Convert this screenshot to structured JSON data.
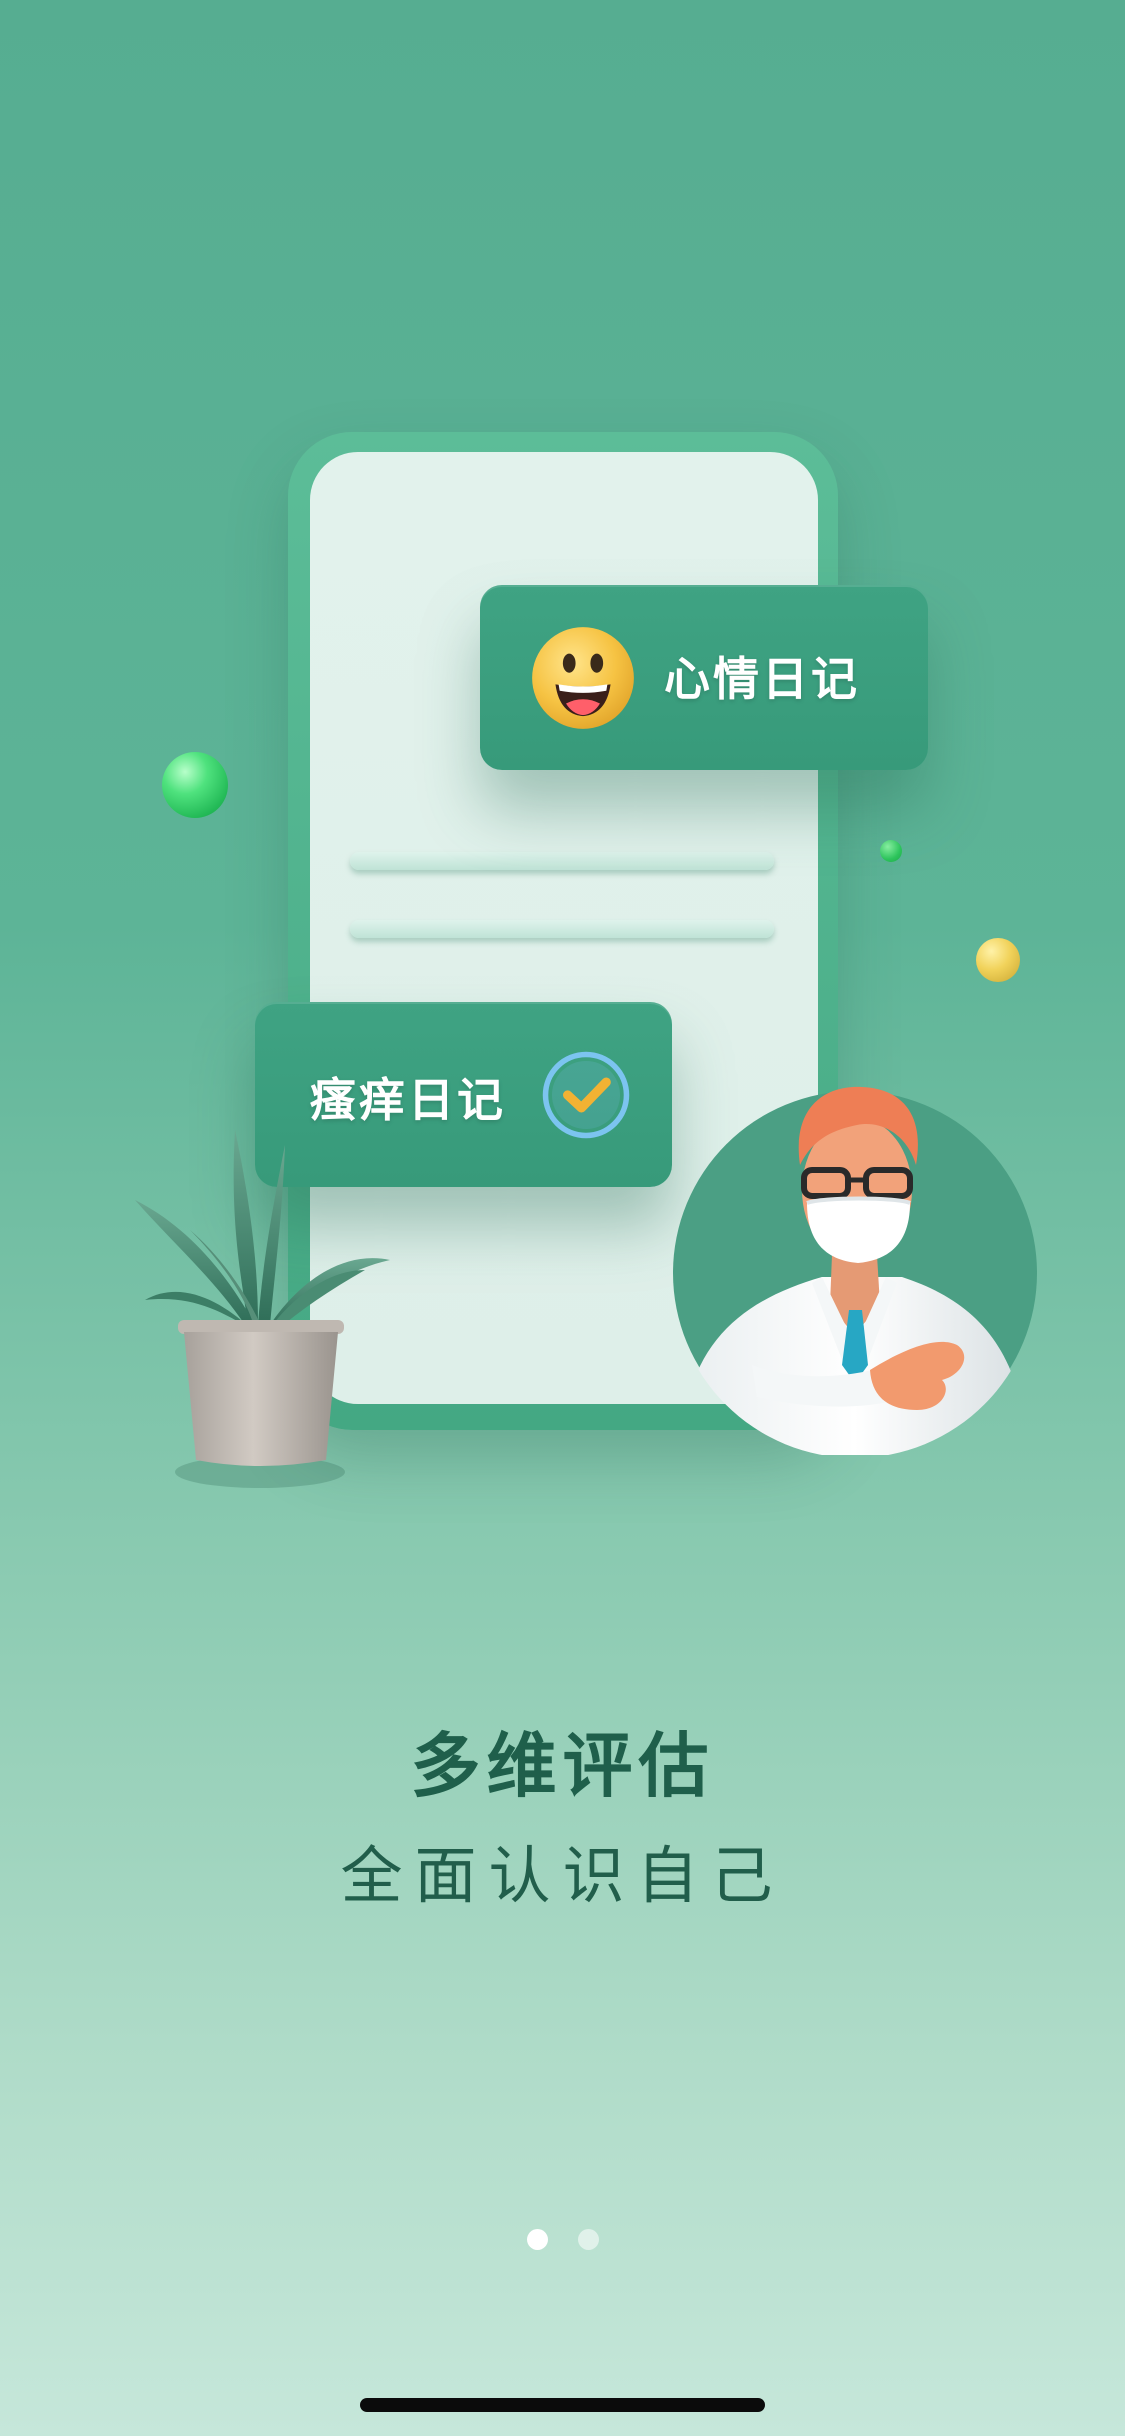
{
  "onboarding": {
    "card_mood_label": "心情日记",
    "card_itch_label": "瘙痒日记",
    "headline": "多维评估",
    "subline": "全面认识自己"
  },
  "pager": {
    "total_pages": 2,
    "current_page": 1
  },
  "icons": {
    "mood": "smiling-face-icon",
    "itch": "checkmark-circle-icon",
    "illustration_plant": "potted-plant-icon",
    "illustration_doctor": "doctor-avatar-icon"
  },
  "colors": {
    "background_top": "#56ad91",
    "background_bottom": "#c6e7da",
    "card": "#3fa383",
    "headline_text": "#1f5f4b",
    "dot_active": "#ffffff"
  }
}
